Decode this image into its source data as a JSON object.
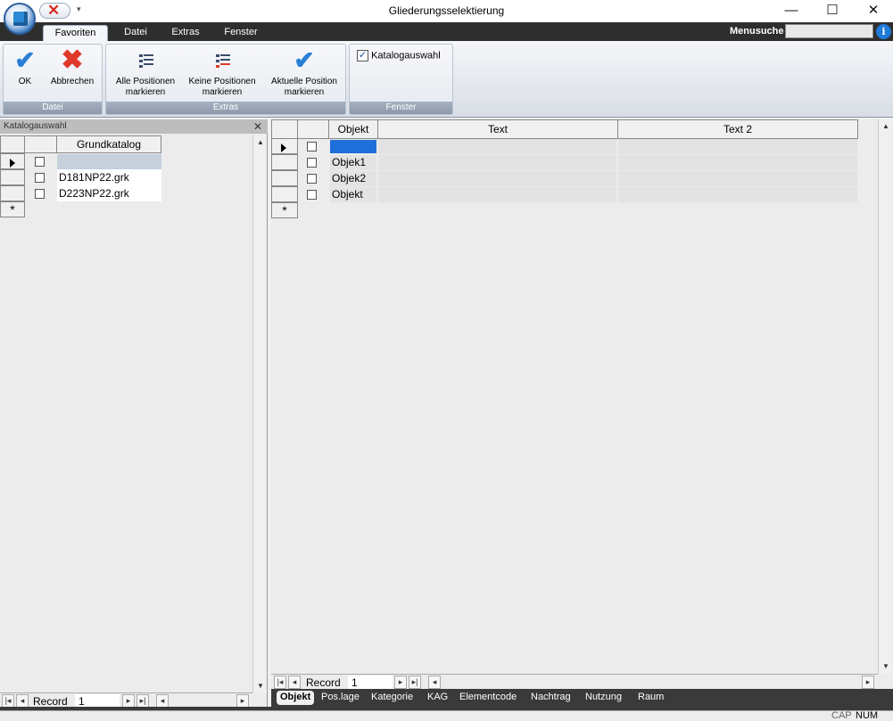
{
  "window": {
    "title": "Gliederungsselektierung"
  },
  "ribbon_tabs": [
    "Favoriten",
    "Datei",
    "Extras",
    "Fenster"
  ],
  "menusuche": {
    "label": "Menusuche",
    "value": ""
  },
  "ribbon": {
    "groups": {
      "datei": "Datei",
      "extras": "Extras",
      "fenster": "Fenster"
    },
    "buttons": {
      "ok": "OK",
      "abbrechen": "Abbrechen",
      "alle_line1": "Alle Positionen",
      "alle_line2": "markieren",
      "keine_line1": "Keine Positionen",
      "keine_line2": "markieren",
      "aktuelle_line1": "Aktuelle Position",
      "aktuelle_line2": "markieren"
    },
    "katalogauswahl_checkbox": {
      "label": "Katalogauswahl",
      "checked": true
    }
  },
  "left_pane": {
    "title": "Katalogauswahl",
    "column": "Grundkatalog",
    "rows": [
      "",
      "D181NP22.grk",
      "D223NP22.grk"
    ],
    "navigator": {
      "label": "Record",
      "value": "1"
    }
  },
  "right_pane": {
    "columns": [
      "Objekt",
      "Text",
      "Text 2"
    ],
    "rows": [
      {
        "objekt": "",
        "text": "",
        "text2": ""
      },
      {
        "objekt": "Objek1",
        "text": "",
        "text2": ""
      },
      {
        "objekt": "Objek2",
        "text": "",
        "text2": ""
      },
      {
        "objekt": "Objekt",
        "text": "",
        "text2": ""
      }
    ],
    "navigator": {
      "label": "Record",
      "value": "1"
    }
  },
  "bottom_tabs": [
    "Objekt",
    "Pos.lage",
    "Kategorie",
    "KAG",
    "Elementcode",
    "Nachtrag",
    "Nutzung",
    "Raum"
  ],
  "status": {
    "cap": "CAP",
    "num": "NUM"
  },
  "colors": {
    "accent": "#2a7fd4",
    "cancel": "#e0392b",
    "selection": "#1e6fd9"
  }
}
